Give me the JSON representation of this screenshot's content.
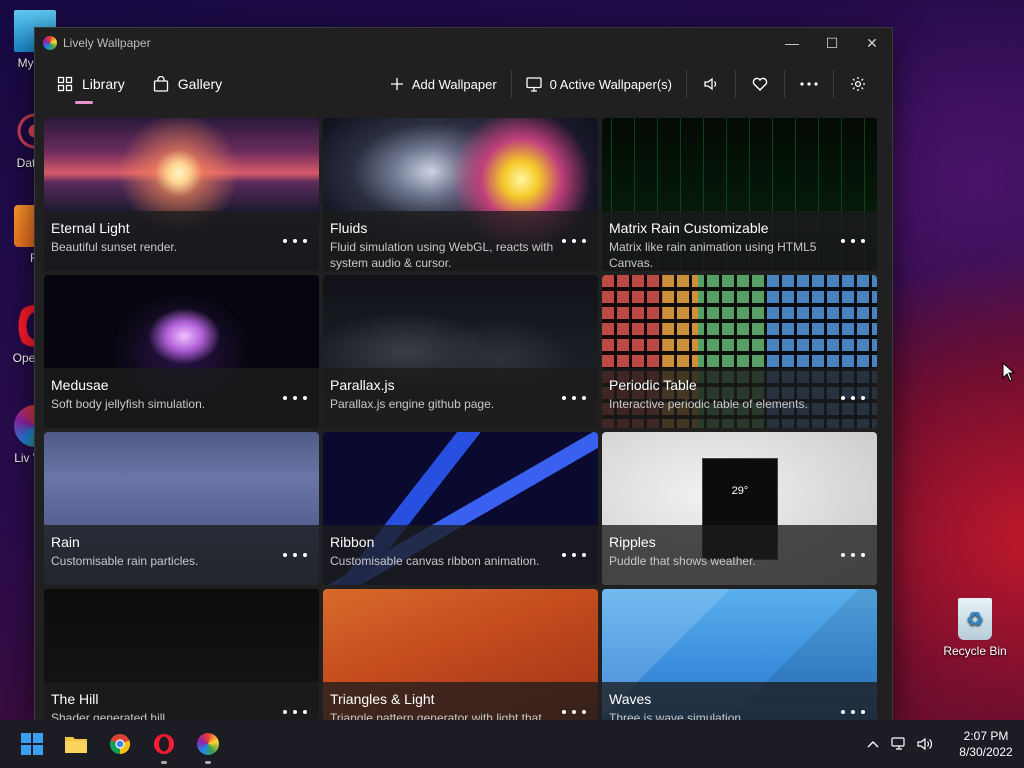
{
  "desktop": {
    "icons": [
      {
        "label": "My Co"
      },
      {
        "label": "DataW"
      },
      {
        "label": "Fi"
      },
      {
        "label": "Ope Bro"
      },
      {
        "label": "Liv Wall"
      },
      {
        "label": "Recycle Bin"
      }
    ]
  },
  "window": {
    "title": "Lively Wallpaper",
    "controls": {
      "minimize": "—",
      "maximize": "☐",
      "close": "✕"
    }
  },
  "toolbar": {
    "library_label": "Library",
    "gallery_label": "Gallery",
    "add_label": "Add Wallpaper",
    "active_label": "0 Active Wallpaper(s)"
  },
  "wallpapers": [
    {
      "title": "Eternal Light",
      "desc": "Beautiful sunset render."
    },
    {
      "title": "Fluids",
      "desc": "Fluid simulation using WebGL, reacts with system audio & cursor."
    },
    {
      "title": "Matrix Rain Customizable",
      "desc": "Matrix like rain animation using HTML5 Canvas."
    },
    {
      "title": "Medusae",
      "desc": "Soft body jellyfish simulation."
    },
    {
      "title": "Parallax.js",
      "desc": "Parallax.js engine github page."
    },
    {
      "title": "Periodic Table",
      "desc": "Interactive periodic table of elements."
    },
    {
      "title": "Rain",
      "desc": "Customisable rain particles."
    },
    {
      "title": "Ribbon",
      "desc": "Customisable canvas ribbon animation."
    },
    {
      "title": "Ripples",
      "desc": "Puddle that shows weather."
    },
    {
      "title": "The Hill",
      "desc": "Shader generated hill."
    },
    {
      "title": "Triangles & Light",
      "desc": "Triangle pattern generator with light that"
    },
    {
      "title": "Waves",
      "desc": "Three.js wave simulation."
    }
  ],
  "ripples_weather": {
    "temp": "29°"
  },
  "taskbar": {
    "clock": {
      "time": "2:07 PM",
      "date": "8/30/2022"
    }
  }
}
